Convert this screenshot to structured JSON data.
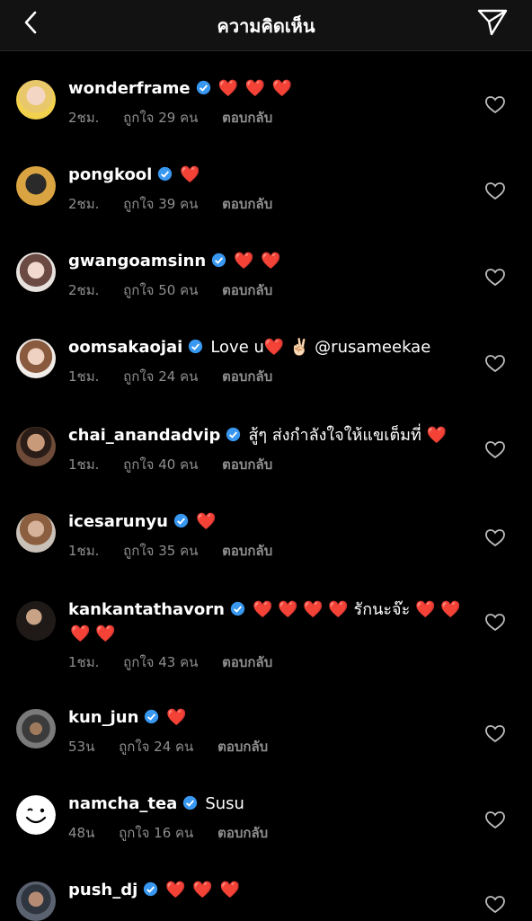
{
  "header": {
    "title": "ความคิดเห็น"
  },
  "comments": [
    {
      "user": "wonderframe",
      "text": "",
      "hearts": "❤️ ❤️ ❤️",
      "time": "2ชม.",
      "likes": "ถูกใจ 29 คน",
      "reply": "ตอบกลับ"
    },
    {
      "user": "pongkool",
      "text": "",
      "hearts": "❤️",
      "time": "2ชม.",
      "likes": "ถูกใจ 39 คน",
      "reply": "ตอบกลับ"
    },
    {
      "user": "gwangoamsinn",
      "text": "",
      "hearts": "❤️ ❤️",
      "time": "2ชม.",
      "likes": "ถูกใจ 50 คน",
      "reply": "ตอบกลับ"
    },
    {
      "user": "oomsakaojai",
      "text": "Love u❤️ ✌🏻 @rusameekae",
      "hearts": "",
      "time": "1ชม.",
      "likes": "ถูกใจ 24 คน",
      "reply": "ตอบกลับ"
    },
    {
      "user": "chai_anandadvip",
      "text": "สู้ๆ ส่งกำลังใจให้แขเต็มที่ ❤️",
      "hearts": "",
      "time": "1ชม.",
      "likes": "ถูกใจ 40 คน",
      "reply": "ตอบกลับ"
    },
    {
      "user": "icesarunyu",
      "text": "",
      "hearts": "❤️",
      "time": "1ชม.",
      "likes": "ถูกใจ 35 คน",
      "reply": "ตอบกลับ"
    },
    {
      "user": "kankantathavorn",
      "text": "❤️ ❤️ ❤️ ❤️ รักนะจ๊ะ ❤️ ❤️",
      "extra": "❤️ ❤️",
      "hearts": "",
      "time": "1ชม.",
      "likes": "ถูกใจ 43 คน",
      "reply": "ตอบกลับ"
    },
    {
      "user": "kun_jun",
      "text": "",
      "hearts": "❤️",
      "time": "53น",
      "likes": "ถูกใจ 24 คน",
      "reply": "ตอบกลับ"
    },
    {
      "user": "namcha_tea",
      "text": "Susu",
      "hearts": "",
      "time": "48น",
      "likes": "ถูกใจ 16 คน",
      "reply": "ตอบกลับ"
    },
    {
      "user": "push_dj",
      "text": "",
      "hearts": "❤️ ❤️ ❤️",
      "time": "",
      "likes": "",
      "reply": ""
    }
  ],
  "colors": {
    "background": "#000000",
    "header": "#121212",
    "verified": "#3897f0",
    "muted": "#8e8e8e",
    "heart": "#e0245e"
  }
}
